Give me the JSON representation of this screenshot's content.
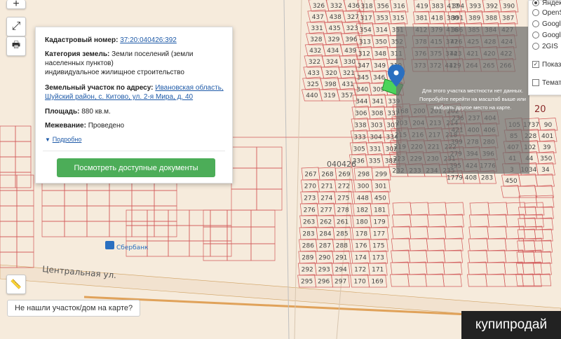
{
  "map_labels": {
    "cadastral_quarter": "040426",
    "street": "Центральная ул.",
    "bank": "Сбербанк",
    "zone": "20",
    "plots": [
      "326",
      "332",
      "436",
      "437",
      "438",
      "327",
      "331",
      "435",
      "323",
      "328",
      "329",
      "396",
      "432",
      "434",
      "439",
      "322",
      "324",
      "330",
      "433",
      "320",
      "321",
      "325",
      "398",
      "431",
      "440",
      "319",
      "357",
      "318",
      "356",
      "316",
      "317",
      "353",
      "315",
      "354",
      "314",
      "351",
      "313",
      "350",
      "352",
      "312",
      "348",
      "311",
      "347",
      "349",
      "310",
      "345",
      "346",
      "343",
      "340",
      "309",
      "342",
      "344",
      "341",
      "339",
      "306",
      "308",
      "337",
      "338",
      "303",
      "307",
      "333",
      "304",
      "334",
      "305",
      "331",
      "302",
      "336",
      "335",
      "382",
      "419",
      "383",
      "417",
      "381",
      "418",
      "380",
      "412",
      "379",
      "416",
      "378",
      "415",
      "377",
      "376",
      "375",
      "374",
      "373",
      "372",
      "411",
      "394",
      "393",
      "392",
      "390",
      "391",
      "389",
      "388",
      "387",
      "386",
      "385",
      "384",
      "427",
      "426",
      "425",
      "428",
      "424",
      "423",
      "421",
      "420",
      "422",
      "429",
      "264",
      "265",
      "266",
      "267",
      "268",
      "269",
      "270",
      "271",
      "272",
      "273",
      "274",
      "275",
      "276",
      "277",
      "278",
      "263",
      "262",
      "261",
      "283",
      "284",
      "285",
      "286",
      "287",
      "288",
      "289",
      "290",
      "291",
      "292",
      "293",
      "294",
      "295",
      "296",
      "297",
      "298",
      "299",
      "300",
      "301",
      "448",
      "450",
      "182",
      "181",
      "180",
      "179",
      "178",
      "177",
      "176",
      "175",
      "174",
      "173",
      "172",
      "171",
      "170",
      "169",
      "168",
      "200",
      "201",
      "202",
      "203",
      "204",
      "213",
      "214",
      "215",
      "216",
      "217",
      "218",
      "219",
      "220",
      "221",
      "222",
      "223",
      "229",
      "230",
      "231",
      "232",
      "233",
      "234",
      "235",
      "236",
      "237",
      "404",
      "421",
      "400",
      "406",
      "399",
      "278",
      "280",
      "279",
      "394",
      "396",
      "395",
      "424",
      "1776",
      "1779",
      "408",
      "283",
      "105",
      "1737",
      "90",
      "85",
      "228",
      "401",
      "407",
      "102",
      "39",
      "41",
      "44",
      "350",
      "3",
      "1034",
      "34",
      "450"
    ]
  },
  "controls": {
    "zoom_in": "+",
    "zoom_out": "−",
    "fullscreen": "⤢",
    "print": "🖶",
    "ruler": "📏"
  },
  "popup": {
    "cadastral_label": "Кадастровый номер:",
    "cadastral_value": "37:20:040426:392",
    "category_label": "Категория земель:",
    "category_value": "Земли поселений (земли населенных пунктов)",
    "use_value": "индивидуальное жилищное строительство",
    "address_label": "Земельный участок по адресу:",
    "address_value": "Ивановская область, Шуйский район, с. Китово, ул. 2-я Мира, д. 40",
    "area_label": "Площадь:",
    "area_value": "880 кв.м.",
    "survey_label": "Межевание:",
    "survey_value": "Проведено",
    "more_label": "Подробно",
    "docs_button": "Посмотреть доступные документы"
  },
  "layers": {
    "options": [
      "Яндекс",
      "OpenS",
      "Googl",
      "Googl",
      "2GIS"
    ],
    "selected": 0,
    "checkboxes": [
      {
        "label": "Показ границ",
        "checked": true
      },
      {
        "label": "Темат",
        "checked": false
      }
    ]
  },
  "overlay_message": "Для этого участка местности нет данных. Попробуйте перейти на масштаб выше или выбрать другое место на карте.",
  "not_found": "Не нашли участок/дом на карте?",
  "watermark": "купипродай",
  "colors": {
    "map_bg": "#f6ebdc",
    "plot_stroke": "#d25a5a",
    "highlight": "#4bd45a",
    "pin": "#2a6fc0",
    "button": "#4cad58",
    "overlay": "#6e6e6e"
  }
}
